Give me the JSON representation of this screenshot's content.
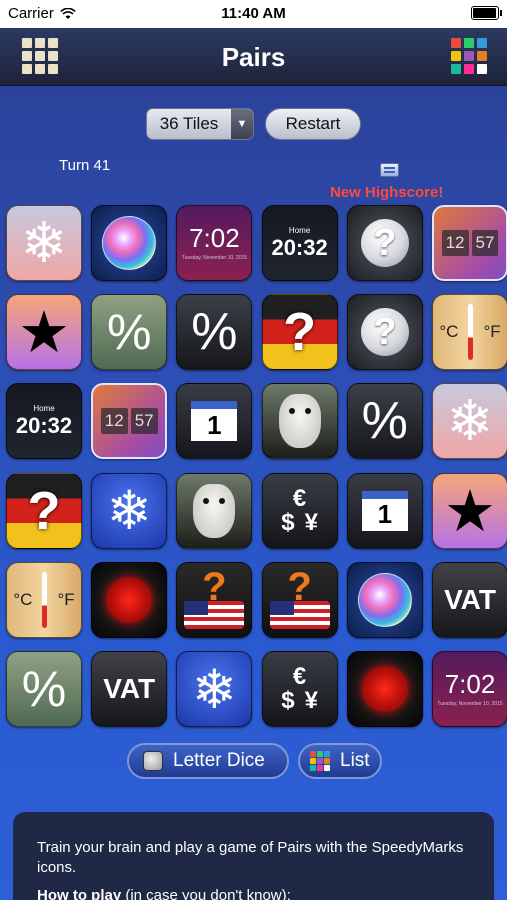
{
  "status": {
    "carrier": "Carrier",
    "time": "11:40 AM",
    "battery_level": 1.0
  },
  "nav": {
    "title": "Pairs"
  },
  "controls": {
    "tiles_select": "36 Tiles",
    "restart": "Restart"
  },
  "game": {
    "turn": "Turn 41",
    "highscore": "New Highscore!"
  },
  "tiles": [
    {
      "kind": "snow",
      "text": "❄"
    },
    {
      "kind": "bubble"
    },
    {
      "kind": "clock7",
      "big": "7:02",
      "small": "Tuesday, November 10, 2015"
    },
    {
      "kind": "home",
      "small": "Home",
      "big": "20:32"
    },
    {
      "kind": "q"
    },
    {
      "kind": "flip",
      "a": "12",
      "b": "57",
      "selected": true
    },
    {
      "kind": "star",
      "text": "★"
    },
    {
      "kind": "pct-money",
      "text": "%"
    },
    {
      "kind": "pct",
      "text": "%"
    },
    {
      "kind": "germany",
      "text": "?"
    },
    {
      "kind": "q"
    },
    {
      "kind": "thermo",
      "a": "°C",
      "b": "°F"
    },
    {
      "kind": "home",
      "small": "Home",
      "big": "20:32"
    },
    {
      "kind": "flip",
      "a": "12",
      "b": "57",
      "selected": true
    },
    {
      "kind": "cal",
      "text": "1"
    },
    {
      "kind": "goat"
    },
    {
      "kind": "pct",
      "text": "%"
    },
    {
      "kind": "snow",
      "text": "❄"
    },
    {
      "kind": "germany",
      "text": "?"
    },
    {
      "kind": "snowblue",
      "text": "❄"
    },
    {
      "kind": "goat"
    },
    {
      "kind": "curr",
      "a": "€",
      "b": "$",
      "c": "¥"
    },
    {
      "kind": "cal",
      "text": "1"
    },
    {
      "kind": "star",
      "text": "★"
    },
    {
      "kind": "thermo",
      "a": "°C",
      "b": "°F"
    },
    {
      "kind": "red"
    },
    {
      "kind": "usa",
      "text": "?"
    },
    {
      "kind": "usa",
      "text": "?"
    },
    {
      "kind": "bubble"
    },
    {
      "kind": "vat",
      "text": "VAT"
    },
    {
      "kind": "pct-money",
      "text": "%"
    },
    {
      "kind": "vat",
      "text": "VAT"
    },
    {
      "kind": "snowblue",
      "text": "❄"
    },
    {
      "kind": "curr",
      "a": "€",
      "b": "$",
      "c": "¥"
    },
    {
      "kind": "red"
    },
    {
      "kind": "clock7",
      "big": "7:02",
      "small": "Tuesday, November 10, 2015"
    }
  ],
  "bottom": {
    "letter_dice": "Letter Dice",
    "list": "List"
  },
  "info": {
    "intro": "Train your brain and play a game of Pairs with the SpeedyMarks icons.",
    "howto_bold": "How to play",
    "howto_rest": " (in case you don't know):"
  },
  "colors": {
    "grid_icon": [
      "#e74c3c",
      "#2ecc71",
      "#3498db",
      "#f1c40f",
      "#9b59b6",
      "#e67e22",
      "#1abc9c",
      "#ff2d95",
      "#ffffff"
    ],
    "list_icon": [
      "#e74c3c",
      "#2ecc71",
      "#3498db",
      "#f1c40f",
      "#9b59b6",
      "#e67e22",
      "#1abc9c",
      "#ff2d95",
      "#ffffff"
    ]
  }
}
